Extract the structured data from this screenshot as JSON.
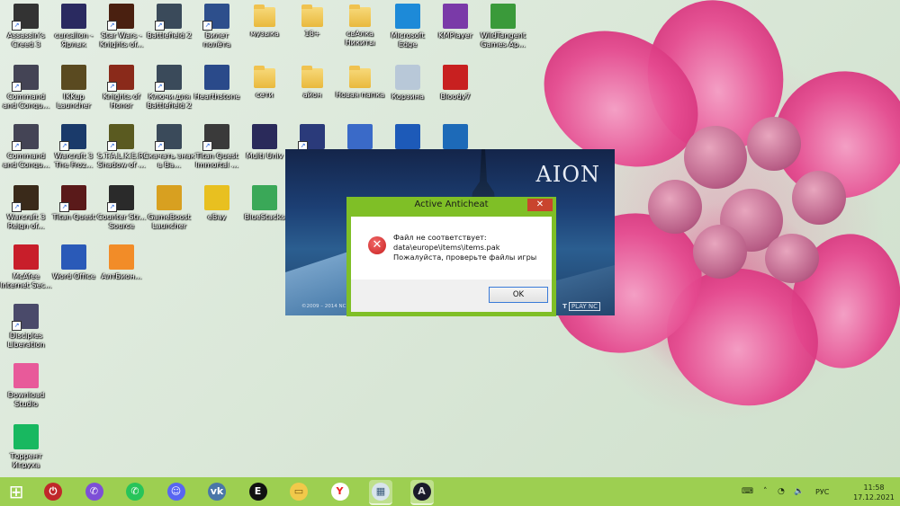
{
  "desktop": {
    "icons": [
      {
        "label": "Assassin's Creed 3",
        "kind": "game",
        "color": "#333"
      },
      {
        "label": "curcalion - Ярлык",
        "kind": "app",
        "color": "#2a2a60"
      },
      {
        "label": "Star Wars - Knights of...",
        "kind": "game",
        "color": "#4a2010"
      },
      {
        "label": "Battlefield 2",
        "kind": "shortcut",
        "color": "#3a4a5a"
      },
      {
        "label": "Билет полёта",
        "kind": "shortcut",
        "color": "#2d4f8c"
      },
      {
        "label": "музыка",
        "kind": "folder",
        "color": "#e9b93d"
      },
      {
        "label": "18+",
        "kind": "folder",
        "color": "#e9b93d"
      },
      {
        "label": "свАлка Никиты",
        "kind": "folder",
        "color": "#e9b93d"
      },
      {
        "label": "Microsoft Edge",
        "kind": "app",
        "color": "#1d8ad8"
      },
      {
        "label": "KMPlayer",
        "kind": "app",
        "color": "#7a3aa8"
      },
      {
        "label": "WildTangent Games Ap...",
        "kind": "app",
        "color": "#3a9a3a"
      },
      {
        "label": "Command and Conqu...",
        "kind": "game",
        "color": "#445"
      },
      {
        "label": "IKKup Launcher",
        "kind": "app",
        "color": "#5a4a20"
      },
      {
        "label": "Knights of Honor",
        "kind": "game",
        "color": "#8a2a1a"
      },
      {
        "label": "Ключи для Battlefield 2",
        "kind": "shortcut",
        "color": "#3a4a5a"
      },
      {
        "label": "Hearthstone",
        "kind": "app",
        "color": "#2a4a8a"
      },
      {
        "label": "сети",
        "kind": "folder",
        "color": "#e9b93d"
      },
      {
        "label": "айон",
        "kind": "folder",
        "color": "#e9b93d"
      },
      {
        "label": "Новая папка",
        "kind": "folder",
        "color": "#e9b93d"
      },
      {
        "label": "Корзина",
        "kind": "trash",
        "color": "#b8c8d8"
      },
      {
        "label": "Bloody7",
        "kind": "app",
        "color": "#c82020"
      },
      {
        "label": "Command and Conqu...",
        "kind": "game",
        "color": "#445"
      },
      {
        "label": "Warcraft 3 The Froz...",
        "kind": "game",
        "color": "#1a3a6a"
      },
      {
        "label": "S.T.A.L.K.E.R. Shadow of ...",
        "kind": "game",
        "color": "#5a5a20"
      },
      {
        "label": "Скачать знак в Ва...",
        "kind": "shortcut",
        "color": "#3a4a5a"
      },
      {
        "label": "Titan Quest Immortal ...",
        "kind": "game",
        "color": "#3a3a3a"
      },
      {
        "label": "Multi Univ",
        "kind": "app",
        "color": "#2a2a5a"
      },
      {
        "label": "",
        "kind": "shortcut",
        "color": "#2a3a7a"
      },
      {
        "label": "",
        "kind": "app",
        "color": "#3a6ac8"
      },
      {
        "label": "",
        "kind": "app",
        "color": "#1d5ab8"
      },
      {
        "label": "",
        "kind": "app",
        "color": "#1d6ab8"
      },
      {
        "label": "Warcraft 3 Reign of...",
        "kind": "game",
        "color": "#3a2a1a"
      },
      {
        "label": "Titan Quest",
        "kind": "game",
        "color": "#5a1a1a"
      },
      {
        "label": "Counter Str... Source",
        "kind": "game",
        "color": "#2a2a2a"
      },
      {
        "label": "GameBoost Launcher",
        "kind": "app",
        "color": "#d8a020"
      },
      {
        "label": "eBay",
        "kind": "app",
        "color": "#e8c020"
      },
      {
        "label": "BlueStacks",
        "kind": "app",
        "color": "#3aa858"
      },
      {
        "label": "McAfee Internet Sec...",
        "kind": "app",
        "color": "#c81e2a"
      },
      {
        "label": "Word Office",
        "kind": "app",
        "color": "#2a5ab8"
      },
      {
        "label": "АлтБион...",
        "kind": "file",
        "color": "#f28c28"
      },
      {
        "label": "Disciples Liberation",
        "kind": "game",
        "color": "#4a4a6a"
      },
      {
        "label": "Download Studio",
        "kind": "app",
        "color": "#e85a9a"
      },
      {
        "label": "Торрент Игруха",
        "kind": "app",
        "color": "#18b860"
      }
    ]
  },
  "splash": {
    "logo": "AION",
    "copyright": "©2009 – 2014 NC S... Aion and Aion Sta...",
    "publisher_tag": "T",
    "plaync": "PLAY NC"
  },
  "dialog": {
    "title": "Active Anticheat",
    "close_glyph": "✕",
    "message": "Файл не соответствует:\ndata\\europe\\items\\items.pak\nПожалуйста, проверьте файлы игры",
    "ok_label": "OK",
    "error_glyph": "✕"
  },
  "taskbar": {
    "start_glyph": "⊞",
    "pinned": [
      {
        "name": "power-app-icon",
        "glyph": "⏻",
        "color": "#c0282a",
        "fg": "#fff"
      },
      {
        "name": "viber-icon",
        "glyph": "✆",
        "color": "#7d4fd6",
        "fg": "#fff"
      },
      {
        "name": "whatsapp-icon",
        "glyph": "✆",
        "color": "#27c45a",
        "fg": "#fff"
      },
      {
        "name": "discord-icon",
        "glyph": "☺",
        "color": "#5865f2",
        "fg": "#fff"
      },
      {
        "name": "vk-icon",
        "glyph": "vk",
        "color": "#4a76a8",
        "fg": "#fff"
      },
      {
        "name": "e-app-icon",
        "glyph": "E",
        "color": "#111",
        "fg": "#fff"
      },
      {
        "name": "file-explorer-icon",
        "glyph": "▭",
        "color": "#f1c94a",
        "fg": "#7a5a10"
      },
      {
        "name": "yandex-browser-icon",
        "glyph": "Y",
        "color": "#fff",
        "fg": "#e22"
      },
      {
        "name": "anticheat-icon",
        "glyph": "▦",
        "color": "#d8e4ec",
        "fg": "#3a5a7a"
      },
      {
        "name": "aion-icon",
        "glyph": "A",
        "color": "#1a1a2a",
        "fg": "#ddd"
      }
    ],
    "tray": {
      "lang": "РУС",
      "time": "11:58",
      "date": "17.12.2021"
    }
  }
}
